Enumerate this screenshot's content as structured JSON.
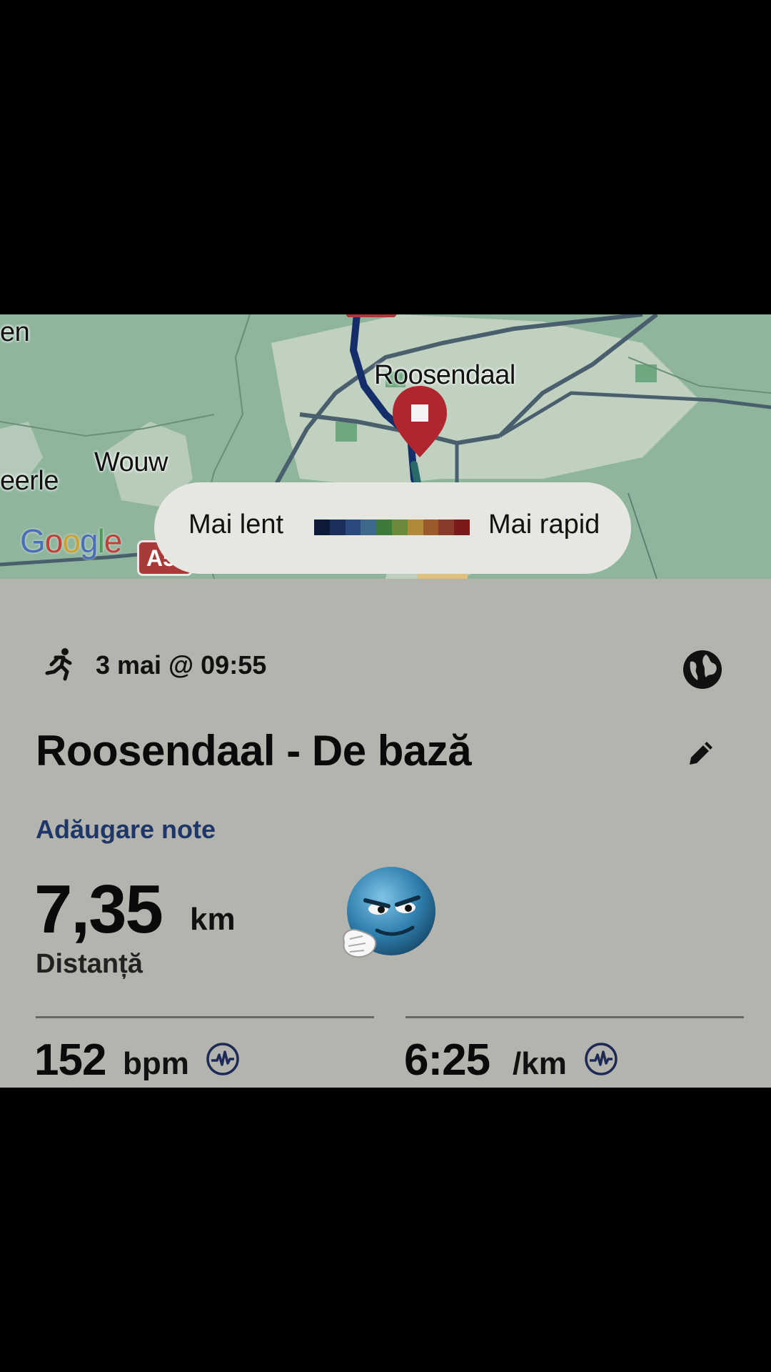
{
  "map": {
    "places": {
      "city": "Roosendaal",
      "town": "Wouw",
      "left_partial_top": "en",
      "left_partial_mid": "eerle"
    },
    "attribution": "Google",
    "road_badge": "A5",
    "legend": {
      "slow_label": "Mai lent",
      "fast_label": "Mai rapid",
      "gradient_colors": [
        "#0d1a3a",
        "#1c2e5a",
        "#2a4a7e",
        "#3d6a8a",
        "#3e7a3a",
        "#6b8a3a",
        "#b08a3a",
        "#9a5a2a",
        "#8a3a2a",
        "#7a1a1a"
      ]
    }
  },
  "activity": {
    "type_icon": "running-icon",
    "date": "3 mai @ 09:55",
    "visibility_icon": "globe-icon",
    "title": "Roosendaal - De bază",
    "edit_icon": "pencil-icon",
    "add_notes": "Adăugare note",
    "distance": {
      "value": "7,35",
      "unit": "km",
      "label": "Distanță"
    },
    "heart_rate": {
      "value": "152",
      "unit": "bpm",
      "icon": "pulse-icon"
    },
    "pace": {
      "value": "6:25",
      "unit": "/km",
      "icon": "pulse-icon"
    }
  },
  "overlay": {
    "emoji": "smirking-blue-face"
  }
}
